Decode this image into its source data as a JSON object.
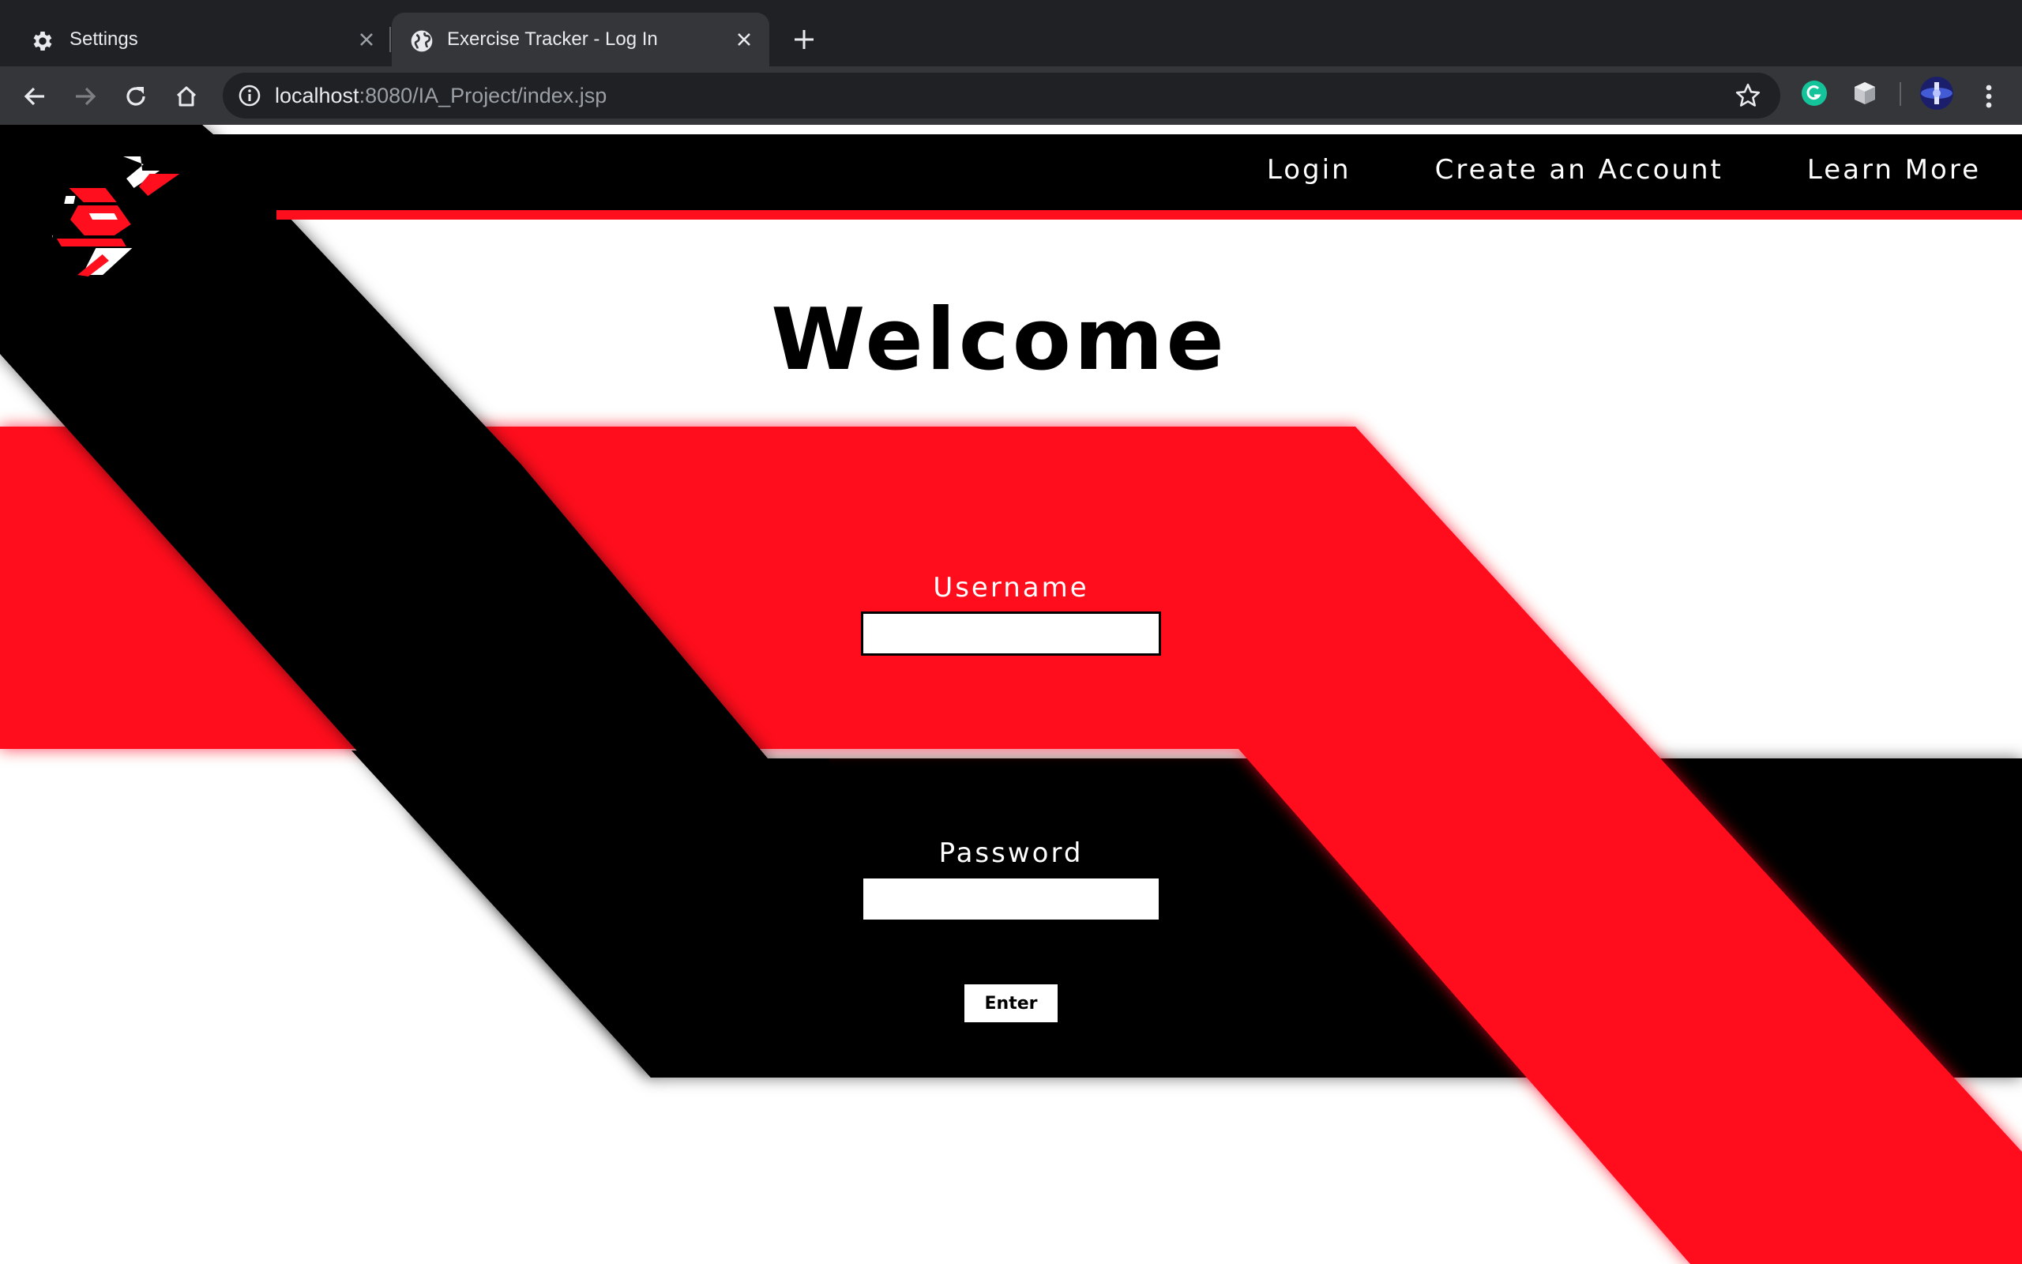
{
  "browser": {
    "tabs": [
      {
        "title": "Settings",
        "icon": "gear-icon",
        "active": false
      },
      {
        "title": "Exercise Tracker - Log In",
        "icon": "globe-icon",
        "active": true
      }
    ],
    "address_bar": {
      "host": "localhost",
      "rest": ":8080/IA_Project/index.jsp"
    },
    "extensions": [
      "grammarly-icon",
      "cube-extension-icon",
      "profile-avatar"
    ]
  },
  "site": {
    "nav": {
      "login": "Login",
      "create_account": "Create an Account",
      "learn_more": "Learn More"
    },
    "heading": "Welcome",
    "form": {
      "username_label": "Username",
      "username_value": "",
      "password_label": "Password",
      "password_value": "",
      "submit_label": "Enter"
    },
    "colors": {
      "accent_red": "#ff0f1e",
      "black": "#000000",
      "white": "#ffffff"
    }
  }
}
